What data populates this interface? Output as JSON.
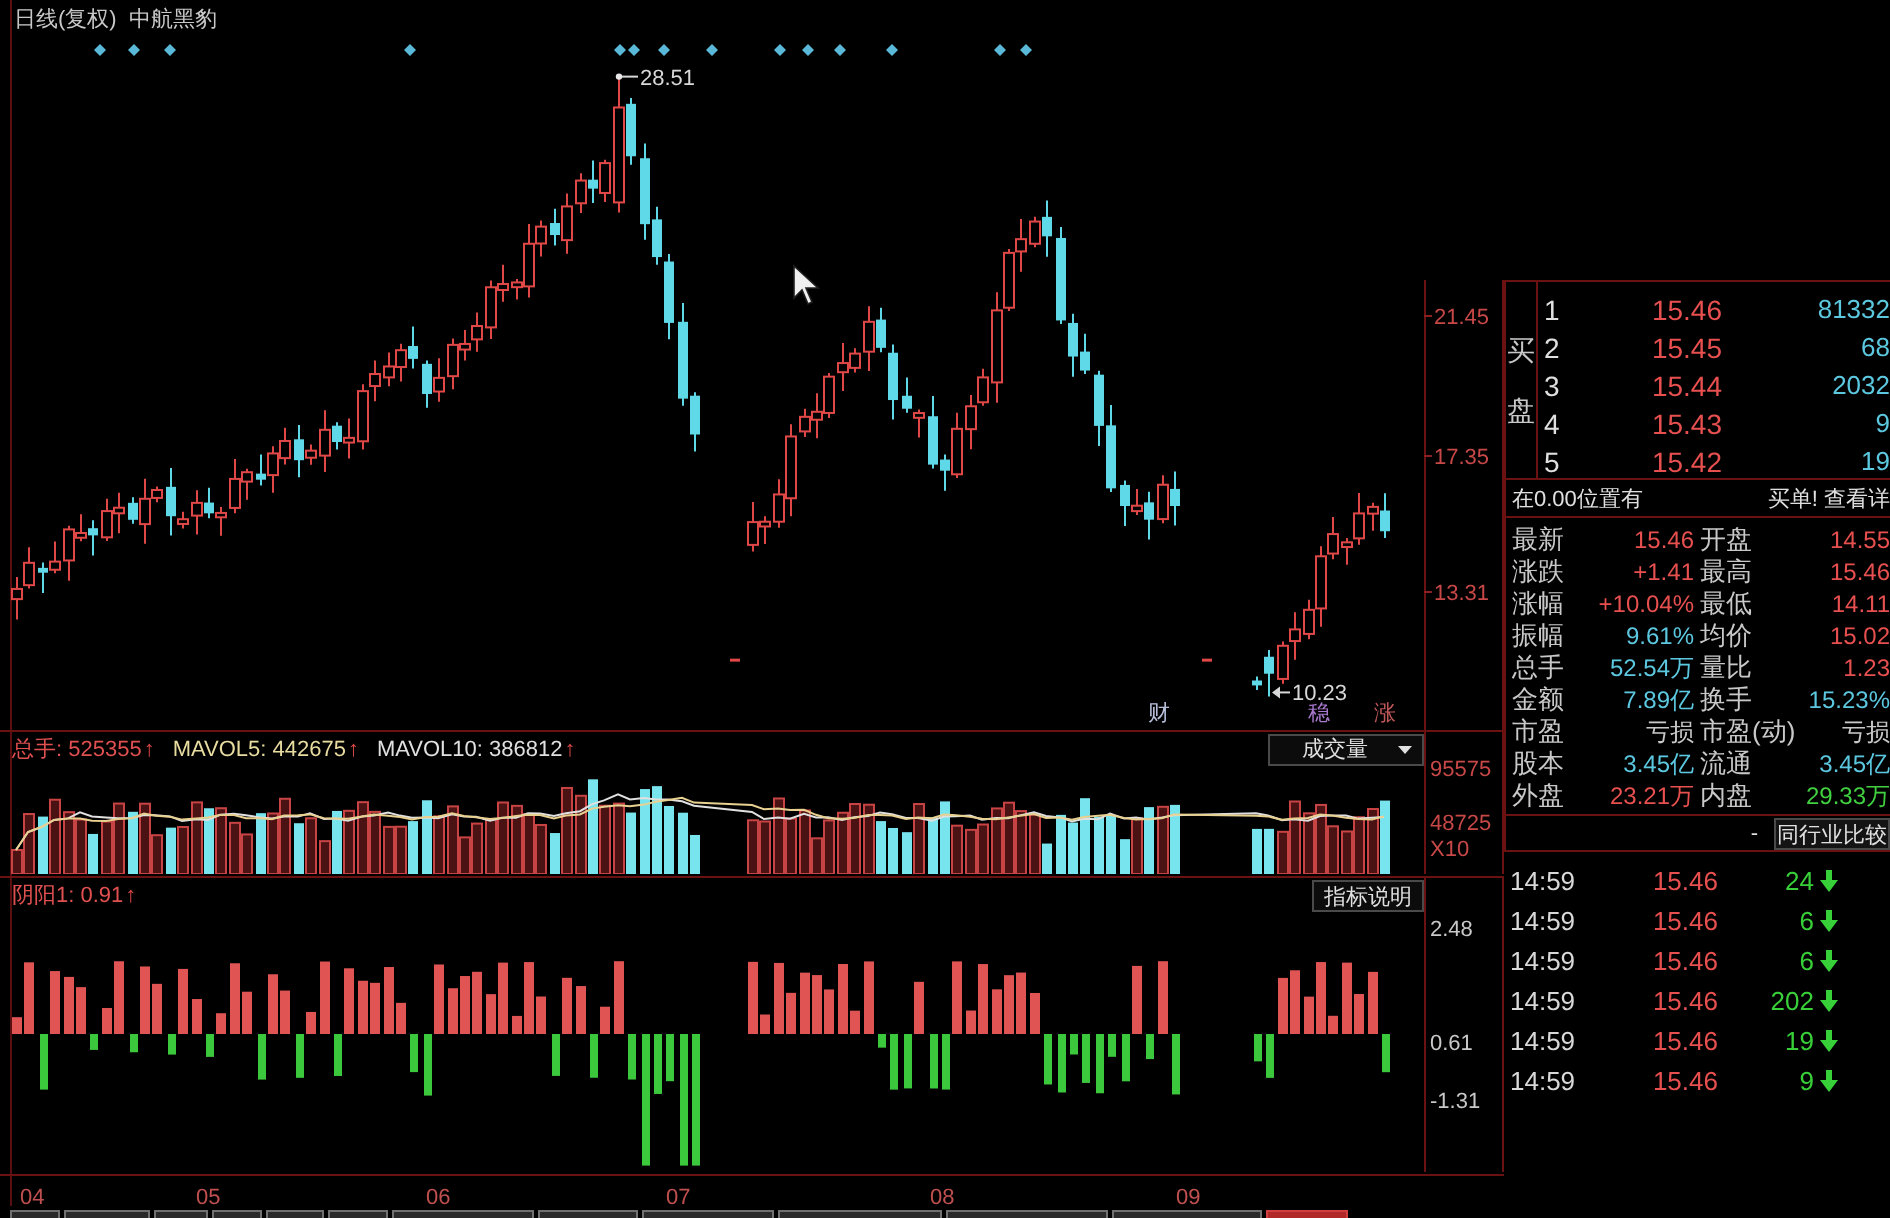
{
  "chart_title": {
    "period": "日线(复权)",
    "security": "中航黑豹"
  },
  "price_chart": {
    "yticks": [
      "21.45",
      "17.35",
      "13.31"
    ],
    "high_label": "28.51",
    "low_label": "10.23",
    "event_tags": [
      {
        "text": "财",
        "color": "#b8c0dc"
      },
      {
        "text": "稳",
        "color": "#a878cc"
      },
      {
        "text": "涨",
        "color": "#c05858"
      }
    ]
  },
  "volume_panel": {
    "readouts": [
      {
        "text": "总手: 525355",
        "arrow": "↑",
        "color": "#e05050"
      },
      {
        "text": "MAVOL5: 442675",
        "arrow": "↑",
        "color": "#e8dca0"
      },
      {
        "text": "MAVOL10: 386812",
        "arrow": "↑",
        "color": "#e0e0e0"
      }
    ],
    "selector": "成交量",
    "yticks": [
      "95575",
      "48725",
      "X10"
    ]
  },
  "indicator_panel": {
    "readouts": [
      {
        "text": "阴阳1: 0.91",
        "arrow": "↑",
        "color": "#e05050"
      }
    ],
    "help_button": "指标说明",
    "yticks": [
      "2.48",
      "0.61",
      "-1.31"
    ]
  },
  "x_axis": {
    "labels": [
      "04",
      "05",
      "06",
      "07",
      "08",
      "09"
    ]
  },
  "bottom_tabs": [
    {
      "selected": false
    },
    {
      "selected": false
    },
    {
      "selected": false
    },
    {
      "selected": false
    },
    {
      "selected": false
    },
    {
      "selected": false
    },
    {
      "selected": false
    },
    {
      "selected": false
    },
    {
      "selected": false
    },
    {
      "selected": false
    },
    {
      "selected": false
    },
    {
      "selected": false
    },
    {
      "selected": true
    }
  ],
  "order_book": {
    "side_label": "买盘",
    "rows": [
      {
        "rank": "1",
        "price": "15.46",
        "volume": "81332"
      },
      {
        "rank": "2",
        "price": "15.45",
        "volume": "68"
      },
      {
        "rank": "3",
        "price": "15.44",
        "volume": "2032"
      },
      {
        "rank": "4",
        "price": "15.43",
        "volume": "9"
      },
      {
        "rank": "5",
        "price": "15.42",
        "volume": "19"
      }
    ]
  },
  "order_notice": {
    "left": "在0.00位置有",
    "right": "买单! 查看详"
  },
  "quote_rows": [
    {
      "left": {
        "label": "最新",
        "value": "15.46",
        "color": "#e85050"
      },
      "right": {
        "label": "开盘",
        "value": "14.55",
        "color": "#e85050"
      }
    },
    {
      "left": {
        "label": "涨跌",
        "value": "+1.41",
        "color": "#e85050"
      },
      "right": {
        "label": "最高",
        "value": "15.46",
        "color": "#e85050"
      }
    },
    {
      "left": {
        "label": "涨幅",
        "value": "+10.04%",
        "color": "#e85050"
      },
      "right": {
        "label": "最低",
        "value": "14.11",
        "color": "#e85050"
      }
    },
    {
      "left": {
        "label": "振幅",
        "value": "9.61%",
        "color": "#5cc8e0"
      },
      "right": {
        "label": "均价",
        "value": "15.02",
        "color": "#e85050"
      }
    },
    {
      "left": {
        "label": "总手",
        "value": "52.54万",
        "color": "#5cc8e0"
      },
      "right": {
        "label": "量比",
        "value": "1.23",
        "color": "#e85050"
      }
    },
    {
      "left": {
        "label": "金额",
        "value": "7.89亿",
        "color": "#5cc8e0"
      },
      "right": {
        "label": "换手",
        "value": "15.23%",
        "color": "#5cc8e0"
      }
    },
    {
      "left": {
        "label": "市盈",
        "value": "亏损",
        "color": "#c8c8c8"
      },
      "right": {
        "label": "市盈(动)",
        "value": "亏损",
        "color": "#c8c8c8"
      }
    },
    {
      "left": {
        "label": "股本",
        "value": "3.45亿",
        "color": "#5cc8e0"
      },
      "right": {
        "label": "流通",
        "value": "3.45亿",
        "color": "#5cc8e0"
      }
    },
    {
      "left": {
        "label": "外盘",
        "value": "23.21万",
        "color": "#e85050"
      },
      "right": {
        "label": "内盘",
        "value": "29.33万",
        "color": "#40d040"
      }
    }
  ],
  "compare_bar": {
    "dash": "-",
    "button": "同行业比较"
  },
  "trades": [
    {
      "time": "14:59",
      "price": "15.46",
      "volume": "24",
      "sell": true
    },
    {
      "time": "14:59",
      "price": "15.46",
      "volume": "6",
      "sell": true
    },
    {
      "time": "14:59",
      "price": "15.46",
      "volume": "6",
      "sell": true
    },
    {
      "time": "14:59",
      "price": "15.46",
      "volume": "202",
      "sell": true
    },
    {
      "time": "14:59",
      "price": "15.46",
      "volume": "19",
      "sell": true
    },
    {
      "time": "14:59",
      "price": "15.46",
      "volume": "9",
      "sell": true
    }
  ]
}
